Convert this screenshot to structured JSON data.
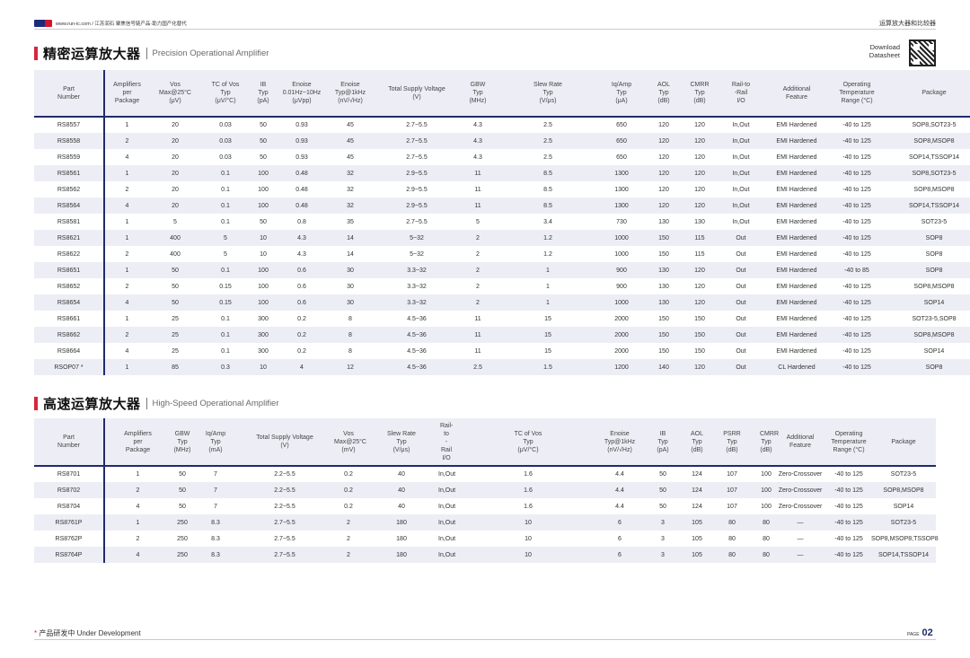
{
  "header": {
    "site": "www.run-ic.com / 江苏润石   聚焦信号链产品·助力国产化替代",
    "category": "运算放大器和比较器"
  },
  "precision": {
    "title_cn": "精密运算放大器",
    "title_en": "Precision Operational Amplifier",
    "headers": [
      "Part\nNumber",
      "Amplifiers\nper\nPackage",
      "Vos\nMax@25°C\n(μV)",
      "TC of Vos\nTyp\n(μV/°C)",
      "IB\nTyp\n(pA)",
      "Enoise\n0.01Hz~10Hz\n(μVpp)",
      "Enoise\nTyp@1kHz\n(nV/√Hz)",
      "Total Supply Voltage\n(V)",
      "GBW\nTyp\n(MHz)",
      "Slew Rate\nTyp\n(V/μs)",
      "Iq/Amp\nTyp\n(μA)",
      "AOL\nTyp\n(dB)",
      "CMRR\nTyp\n(dB)",
      "Rail-to\n-Rail\nI/O",
      "Additional\nFeature",
      "Operating\nTemperature\nRange (°C)",
      "Package"
    ],
    "rows": [
      [
        "RS8557",
        "1",
        "20",
        "0.03",
        "50",
        "0.93",
        "45",
        "2.7~5.5",
        "4.3",
        "2.5",
        "650",
        "120",
        "120",
        "In,Out",
        "EMI Hardened",
        "-40 to 125",
        "SOP8,SOT23-5"
      ],
      [
        "RS8558",
        "2",
        "20",
        "0.03",
        "50",
        "0.93",
        "45",
        "2.7~5.5",
        "4.3",
        "2.5",
        "650",
        "120",
        "120",
        "In,Out",
        "EMI Hardened",
        "-40 to 125",
        "SOP8,MSOP8"
      ],
      [
        "RS8559",
        "4",
        "20",
        "0.03",
        "50",
        "0.93",
        "45",
        "2.7~5.5",
        "4.3",
        "2.5",
        "650",
        "120",
        "120",
        "In,Out",
        "EMI Hardened",
        "-40 to 125",
        "SOP14,TSSOP14"
      ],
      [
        "RS8561",
        "1",
        "20",
        "0.1",
        "100",
        "0.48",
        "32",
        "2.9~5.5",
        "11",
        "8.5",
        "1300",
        "120",
        "120",
        "In,Out",
        "EMI Hardened",
        "-40 to 125",
        "SOP8,SOT23-5"
      ],
      [
        "RS8562",
        "2",
        "20",
        "0.1",
        "100",
        "0.48",
        "32",
        "2.9~5.5",
        "11",
        "8.5",
        "1300",
        "120",
        "120",
        "In,Out",
        "EMI Hardened",
        "-40 to 125",
        "SOP8,MSOP8"
      ],
      [
        "RS8564",
        "4",
        "20",
        "0.1",
        "100",
        "0.48",
        "32",
        "2.9~5.5",
        "11",
        "8.5",
        "1300",
        "120",
        "120",
        "In,Out",
        "EMI Hardened",
        "-40 to 125",
        "SOP14,TSSOP14"
      ],
      [
        "RS8581",
        "1",
        "5",
        "0.1",
        "50",
        "0.8",
        "35",
        "2.7~5.5",
        "5",
        "3.4",
        "730",
        "130",
        "130",
        "In,Out",
        "EMI Hardened",
        "-40 to 125",
        "SOT23-5"
      ],
      [
        "RS8621",
        "1",
        "400",
        "5",
        "10",
        "4.3",
        "14",
        "5~32",
        "2",
        "1.2",
        "1000",
        "150",
        "115",
        "Out",
        "EMI Hardened",
        "-40 to 125",
        "SOP8"
      ],
      [
        "RS8622",
        "2",
        "400",
        "5",
        "10",
        "4.3",
        "14",
        "5~32",
        "2",
        "1.2",
        "1000",
        "150",
        "115",
        "Out",
        "EMI Hardened",
        "-40 to 125",
        "SOP8"
      ],
      [
        "RS8651",
        "1",
        "50",
        "0.1",
        "100",
        "0.6",
        "30",
        "3.3~32",
        "2",
        "1",
        "900",
        "130",
        "120",
        "Out",
        "EMI Hardened",
        "-40 to 85",
        "SOP8"
      ],
      [
        "RS8652",
        "2",
        "50",
        "0.15",
        "100",
        "0.6",
        "30",
        "3.3~32",
        "2",
        "1",
        "900",
        "130",
        "120",
        "Out",
        "EMI Hardened",
        "-40 to 125",
        "SOP8,MSOP8"
      ],
      [
        "RS8654",
        "4",
        "50",
        "0.15",
        "100",
        "0.6",
        "30",
        "3.3~32",
        "2",
        "1",
        "1000",
        "130",
        "120",
        "Out",
        "EMI Hardened",
        "-40 to 125",
        "SOP14"
      ],
      [
        "RS8661",
        "1",
        "25",
        "0.1",
        "300",
        "0.2",
        "8",
        "4.5~36",
        "11",
        "15",
        "2000",
        "150",
        "150",
        "Out",
        "EMI Hardened",
        "-40 to 125",
        "SOT23-5,SOP8"
      ],
      [
        "RS8662",
        "2",
        "25",
        "0.1",
        "300",
        "0.2",
        "8",
        "4.5~36",
        "11",
        "15",
        "2000",
        "150",
        "150",
        "Out",
        "EMI Hardened",
        "-40 to 125",
        "SOP8,MSOP8"
      ],
      [
        "RS8664",
        "4",
        "25",
        "0.1",
        "300",
        "0.2",
        "8",
        "4.5~36",
        "11",
        "15",
        "2000",
        "150",
        "150",
        "Out",
        "EMI Hardened",
        "-40 to 125",
        "SOP14"
      ],
      [
        "RSOP07 *",
        "1",
        "85",
        "0.3",
        "10",
        "4",
        "12",
        "4.5~36",
        "2.5",
        "1.5",
        "1200",
        "140",
        "120",
        "Out",
        "CL Hardened",
        "-40 to 125",
        "SOP8"
      ]
    ]
  },
  "highspeed": {
    "title_cn": "高速运算放大器",
    "title_en": "High-Speed Operational Amplifier",
    "headers": [
      "Part\nNumber",
      "Amplifiers\nper\nPackage",
      "GBW\nTyp\n(MHz)",
      "Iq/Amp\nTyp\n(mA)",
      "Total Supply Voltage\n(V)",
      "Vos\nMax@25°C\n(mV)",
      "Slew Rate\nTyp\n(V/μs)",
      "Rail-to\n-Rail\nI/O",
      "TC of Vos\nTyp\n(μV/°C)",
      "Enoise\nTyp@1kHz\n(nV/√Hz)",
      "IB\nTyp\n(pA)",
      "AOL\nTyp\n(dB)",
      "PSRR\nTyp\n(dB)",
      "CMRR\nTyp\n(dB)",
      "Additional\nFeature",
      "Operating\nTemperature\nRange (°C)",
      "Package"
    ],
    "rows": [
      [
        "RS8701",
        "1",
        "50",
        "7",
        "2.2~5.5",
        "0.2",
        "40",
        "In,Out",
        "1.6",
        "4.4",
        "50",
        "124",
        "107",
        "100",
        "Zero-Crossover",
        "-40 to 125",
        "SOT23-5"
      ],
      [
        "RS8702",
        "2",
        "50",
        "7",
        "2.2~5.5",
        "0.2",
        "40",
        "In,Out",
        "1.6",
        "4.4",
        "50",
        "124",
        "107",
        "100",
        "Zero-Crossover",
        "-40 to 125",
        "SOP8,MSOP8"
      ],
      [
        "RS8704",
        "4",
        "50",
        "7",
        "2.2~5.5",
        "0.2",
        "40",
        "In,Out",
        "1.6",
        "4.4",
        "50",
        "124",
        "107",
        "100",
        "Zero-Crossover",
        "-40 to 125",
        "SOP14"
      ],
      [
        "RS8761P",
        "1",
        "250",
        "8.3",
        "2.7~5.5",
        "2",
        "180",
        "In,Out",
        "10",
        "6",
        "3",
        "105",
        "80",
        "80",
        "—",
        "-40 to 125",
        "SOT23-5"
      ],
      [
        "RS8762P",
        "2",
        "250",
        "8.3",
        "2.7~5.5",
        "2",
        "180",
        "In,Out",
        "10",
        "6",
        "3",
        "105",
        "80",
        "80",
        "—",
        "-40 to 125",
        "SOP8,MSOP8,TSSOP8"
      ],
      [
        "RS8764P",
        "4",
        "250",
        "8.3",
        "2.7~5.5",
        "2",
        "180",
        "In,Out",
        "10",
        "6",
        "3",
        "105",
        "80",
        "80",
        "—",
        "-40 to 125",
        "SOP14,TSSOP14"
      ]
    ]
  },
  "download": "Download\nDatasheet",
  "footer": {
    "star": "*",
    "note": " 产品研发中 Under Development",
    "page_label": "PAGE",
    "page_num": "02"
  }
}
